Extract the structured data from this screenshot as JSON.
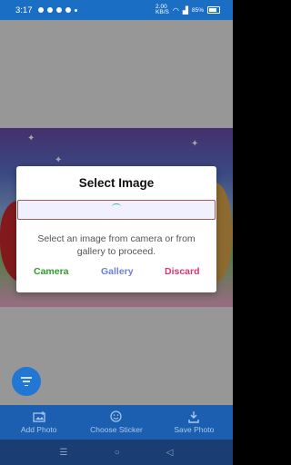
{
  "status_bar": {
    "time": "3:17",
    "network_speed": "2.00\nKB/S",
    "battery": "85%"
  },
  "dialog": {
    "title": "Select Image",
    "message": "Select an image from camera or from gallery to proceed.",
    "buttons": {
      "camera": "Camera",
      "gallery": "Gallery",
      "discard": "Discard"
    },
    "colors": {
      "camera": "#2e9e2a",
      "gallery": "#6f7fd6",
      "discard": "#e0356b"
    }
  },
  "toolbar": {
    "items": [
      {
        "label": "Add Photo",
        "icon": "add-photo-icon"
      },
      {
        "label": "Choose Sticker",
        "icon": "sticker-icon"
      },
      {
        "label": "Save Photo",
        "icon": "download-icon"
      }
    ]
  },
  "fab": {
    "icon": "filter-icon"
  },
  "nav": {
    "icons": [
      "menu-icon",
      "home-icon",
      "back-icon"
    ]
  }
}
